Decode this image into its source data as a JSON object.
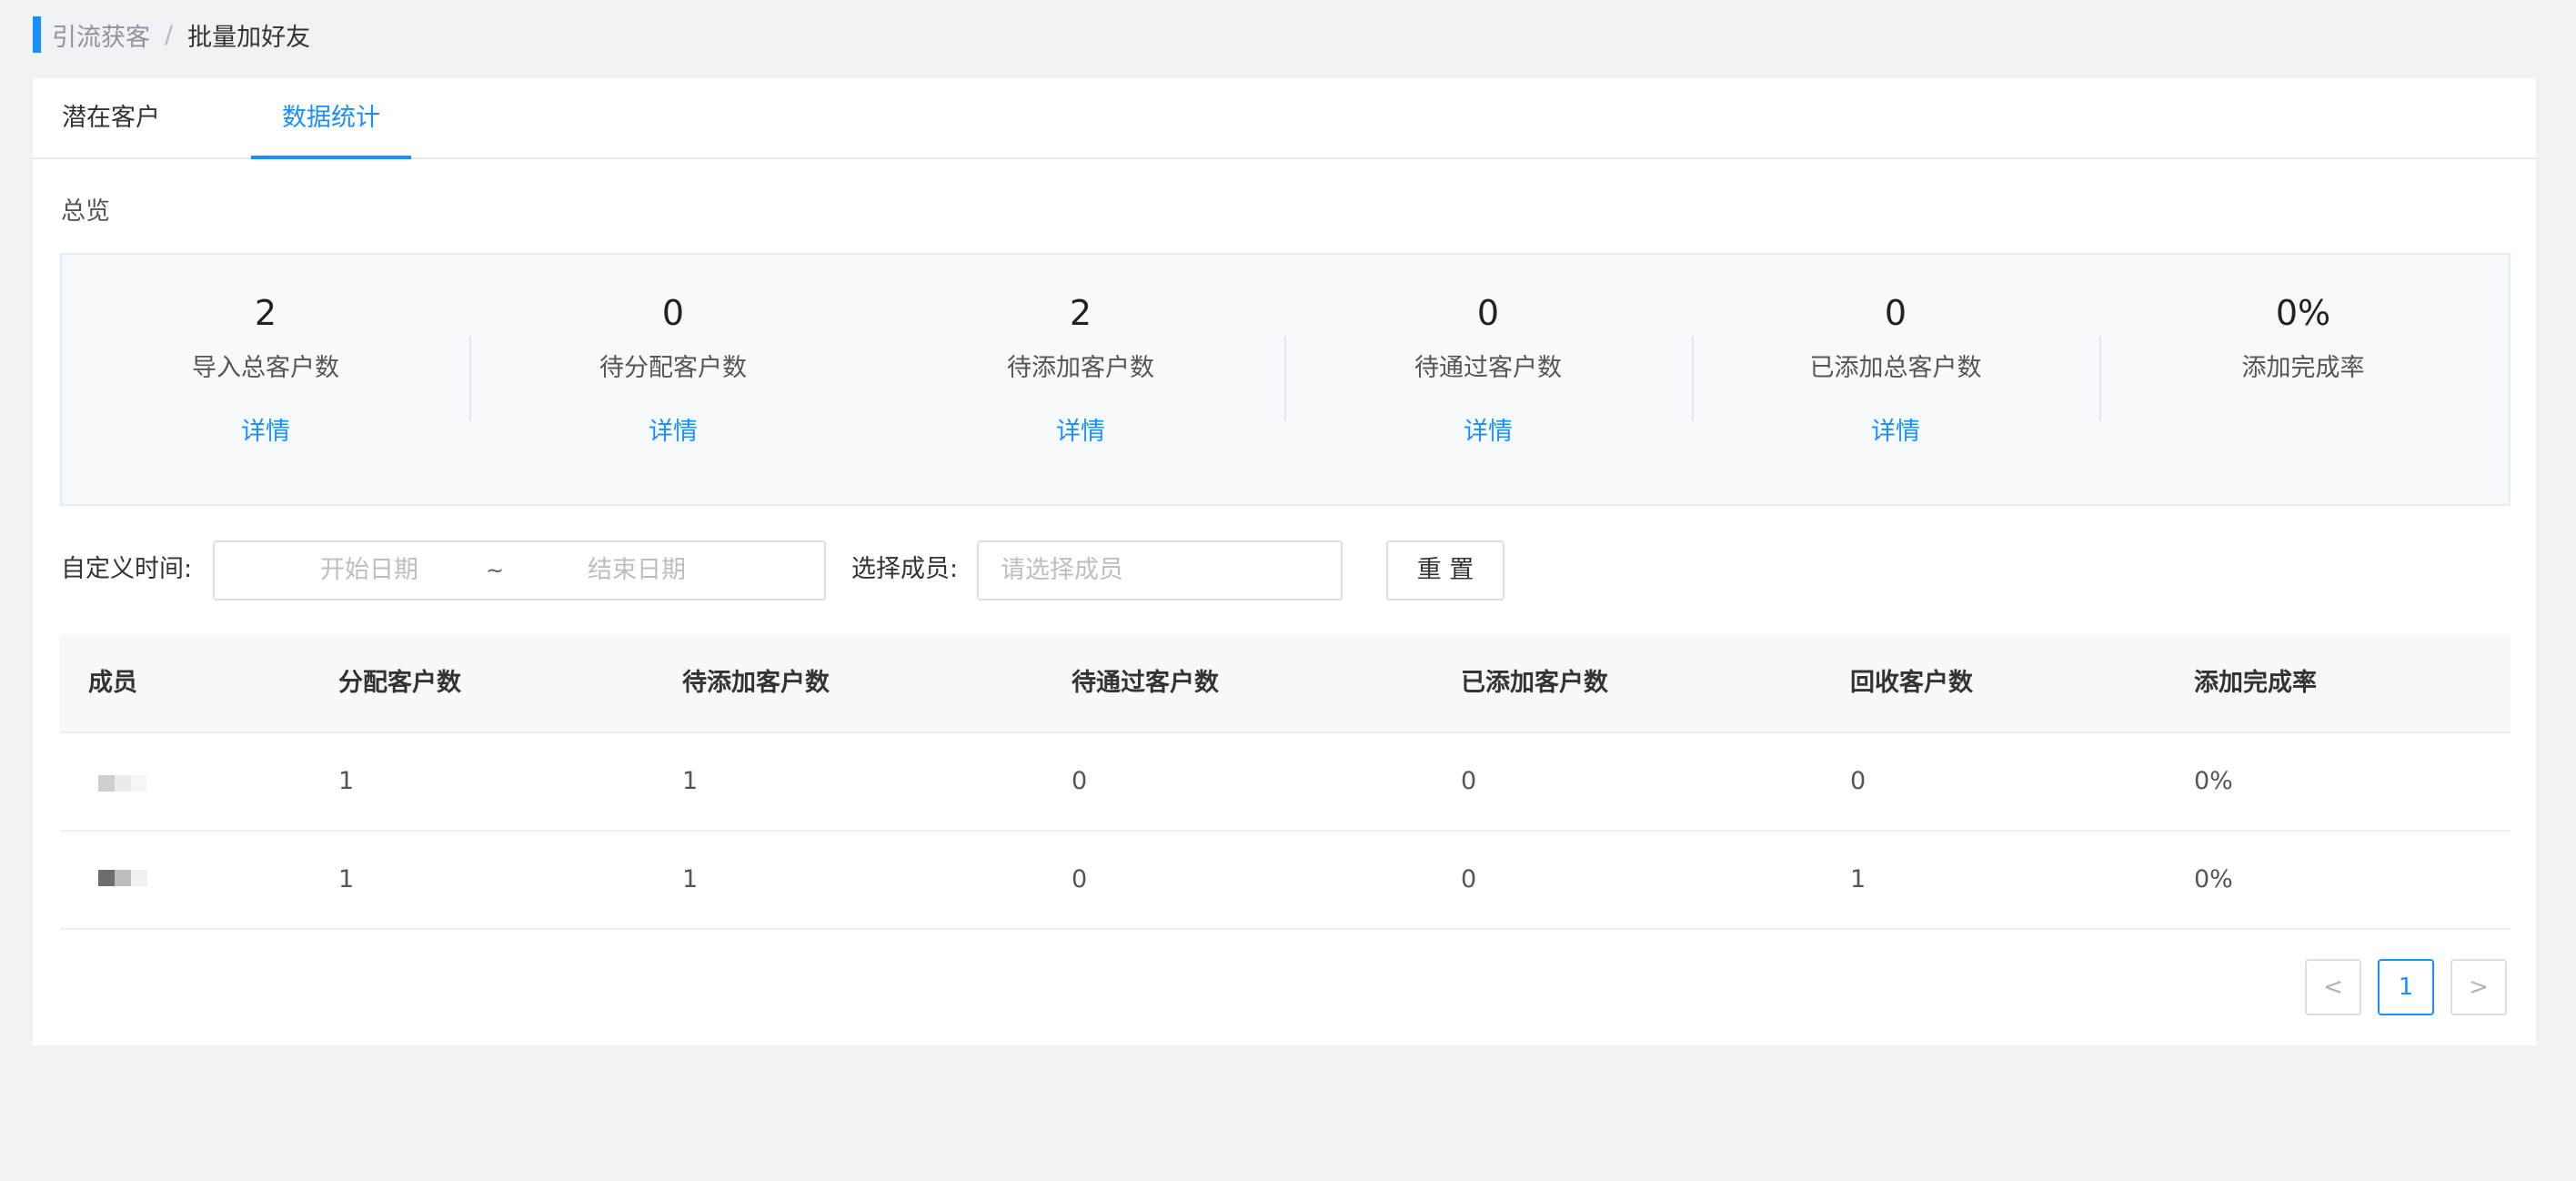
{
  "breadcrumb": {
    "parent": "引流获客",
    "separator": "/",
    "current": "批量加好友"
  },
  "tabs": [
    {
      "label": "潜在客户",
      "active": false
    },
    {
      "label": "数据统计",
      "active": true
    }
  ],
  "overview": {
    "title": "总览",
    "stats": [
      {
        "value": "2",
        "label": "导入总客户数",
        "link": "详情"
      },
      {
        "value": "0",
        "label": "待分配客户数",
        "link": "详情"
      },
      {
        "value": "2",
        "label": "待添加客户数",
        "link": "详情"
      },
      {
        "value": "0",
        "label": "待通过客户数",
        "link": "详情"
      },
      {
        "value": "0",
        "label": "已添加总客户数",
        "link": "详情"
      },
      {
        "value": "0%",
        "label": "添加完成率"
      }
    ]
  },
  "filters": {
    "time_label": "自定义时间:",
    "start_placeholder": "开始日期",
    "range_separator": "~",
    "end_placeholder": "结束日期",
    "member_label": "选择成员:",
    "member_placeholder": "请选择成员",
    "reset_label": "重 置"
  },
  "table": {
    "columns": [
      "成员",
      "分配客户数",
      "待添加客户数",
      "待通过客户数",
      "已添加客户数",
      "回收客户数",
      "添加完成率"
    ],
    "rows": [
      {
        "assigned": "1",
        "pending_add": "1",
        "pending_approve": "0",
        "added": "0",
        "recycled": "0",
        "rate": "0%"
      },
      {
        "assigned": "1",
        "pending_add": "1",
        "pending_approve": "0",
        "added": "0",
        "recycled": "1",
        "rate": "0%"
      }
    ]
  },
  "pagination": {
    "prev": "<",
    "current": "1",
    "next": ">"
  },
  "colors": {
    "accent": "#1890ff",
    "background": "#f0f2f5"
  }
}
